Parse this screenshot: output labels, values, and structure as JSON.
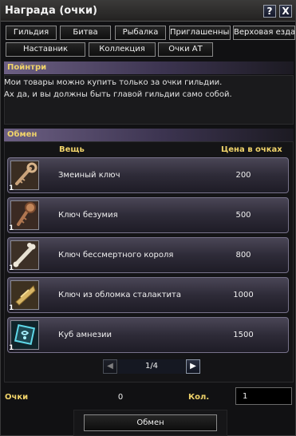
{
  "window": {
    "title": "Награда (очки)",
    "help_label": "?",
    "close_label": "X"
  },
  "tabs_row1": [
    "Гильдия",
    "Битва",
    "Рыбалка",
    "Приглашенные",
    "Верховая езда"
  ],
  "tabs_row2": [
    "Наставник",
    "Коллекция",
    "Очки АТ"
  ],
  "npc": {
    "name": "Пойнтри",
    "lines": [
      "Мои товары можно купить только за очки гильдии.",
      "Ах да, и вы должны быть главой гильдии само собой."
    ]
  },
  "exchange": {
    "header": "Обмен",
    "col_item": "Вещь",
    "col_price": "Цена в очках",
    "items": [
      {
        "name": "Змеиный ключ",
        "price": "200",
        "qty": "1",
        "icon": "serpent-key-icon"
      },
      {
        "name": "Ключ безумия",
        "price": "500",
        "qty": "1",
        "icon": "madness-key-icon"
      },
      {
        "name": "Ключ бессмертного короля",
        "price": "800",
        "qty": "1",
        "icon": "bone-key-icon"
      },
      {
        "name": "Ключ из обломка сталактита",
        "price": "1000",
        "qty": "1",
        "icon": "stalactite-key-icon"
      },
      {
        "name": "Куб амнезии",
        "price": "1500",
        "qty": "1",
        "icon": "amnesia-cube-icon"
      }
    ]
  },
  "pager": {
    "text": "1/4",
    "prev": "◀",
    "next": "▶"
  },
  "footer": {
    "points_label": "Очки",
    "points_value": "0",
    "qty_label": "Кол.",
    "qty_value": "1",
    "exchange_button": "Обмен"
  },
  "colors": {
    "accent": "#f0d36a",
    "section_gradient": "#6c5f83"
  }
}
